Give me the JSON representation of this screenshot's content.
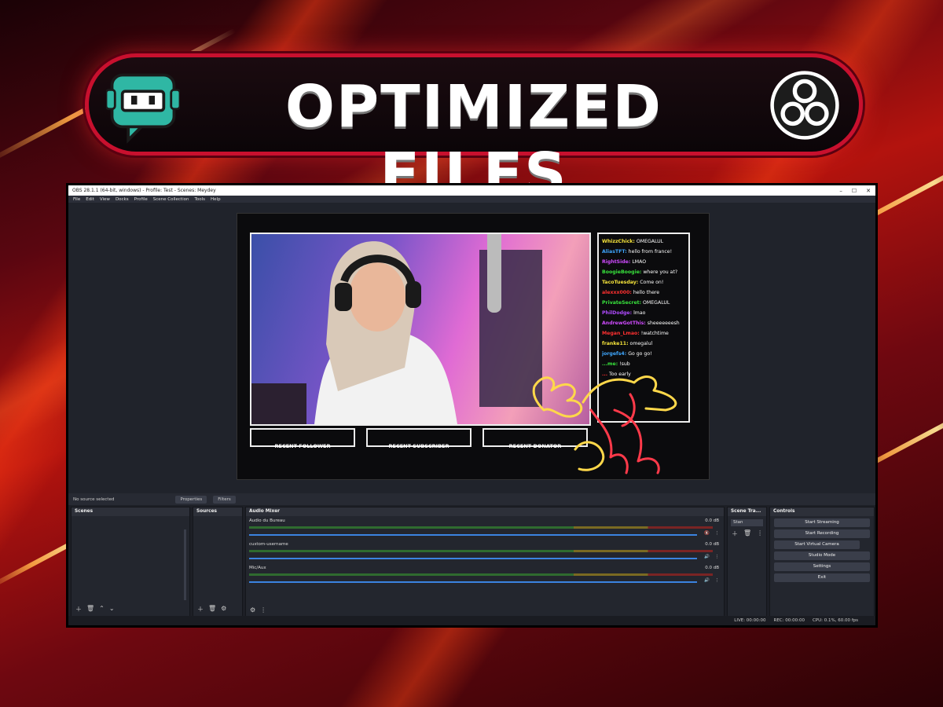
{
  "banner": {
    "title": "OPTIMIZED FILES"
  },
  "window": {
    "title": "OBS 28.1.1 (64-bit, windows) - Profile: Test - Scenes: Meydey",
    "menu": [
      "File",
      "Edit",
      "View",
      "Docks",
      "Profile",
      "Scene Collection",
      "Tools",
      "Help"
    ]
  },
  "chat": [
    {
      "user": "WhizzChick:",
      "msg": "OMEGALUL",
      "color": "#f4e23a"
    },
    {
      "user": "AliasTFT:",
      "msg": "hello from france!",
      "color": "#3fa7ff"
    },
    {
      "user": "RightSide:",
      "msg": "LMAO",
      "color": "#d04bff"
    },
    {
      "user": "BoogieBoogie:",
      "msg": "where you at?",
      "color": "#38e23c"
    },
    {
      "user": "TacoTuesday:",
      "msg": "Come on!",
      "color": "#f4e23a"
    },
    {
      "user": "alexxx000:",
      "msg": "hello there",
      "color": "#ff3030"
    },
    {
      "user": "PrivateSecret:",
      "msg": "OMEGALUL",
      "color": "#38e23c"
    },
    {
      "user": "PhilDodge:",
      "msg": "lmao",
      "color": "#b04bff"
    },
    {
      "user": "AndrewGotThis:",
      "msg": "sheeeeeeesh",
      "color": "#d04bff"
    },
    {
      "user": "Megan_Lmao:",
      "msg": "!watchtime",
      "color": "#ff3030"
    },
    {
      "user": "franke11:",
      "msg": "omegalul",
      "color": "#f4e23a"
    },
    {
      "user": "jorgefs4:",
      "msg": "Go go go!",
      "color": "#3fa7ff"
    },
    {
      "user": "...me:",
      "msg": "!sub",
      "color": "#38e23c"
    },
    {
      "user": "...",
      "msg": "Too early",
      "color": "#ff3030"
    }
  ],
  "alerts": [
    "RECENT FOLLOWER",
    "RECENT SUBSCRIBER",
    "RECENT DONATOR"
  ],
  "sourcebar": {
    "status": "No source selected",
    "properties": "Properties",
    "filters": "Filters"
  },
  "docks": {
    "scenes": "Scenes",
    "sources": "Sources",
    "mixer": "Audio Mixer",
    "transitions": "Scene Tra...",
    "controls": "Controls"
  },
  "mixer": [
    {
      "name": "Audio du Bureau",
      "db": "0.0 dB"
    },
    {
      "name": "custom-username",
      "db": "0.0 dB"
    },
    {
      "name": "Mic/Aux",
      "db": "0.0 dB"
    }
  ],
  "transition": "Stan",
  "controls": [
    "Start Streaming",
    "Start Recording",
    "Start Virtual Camera",
    "Studio Mode",
    "Settings",
    "Exit"
  ],
  "status": {
    "live": "LIVE: 00:00:00",
    "rec": "REC: 00:00:00",
    "cpu": "CPU: 0.1%, 60.00 fps"
  }
}
